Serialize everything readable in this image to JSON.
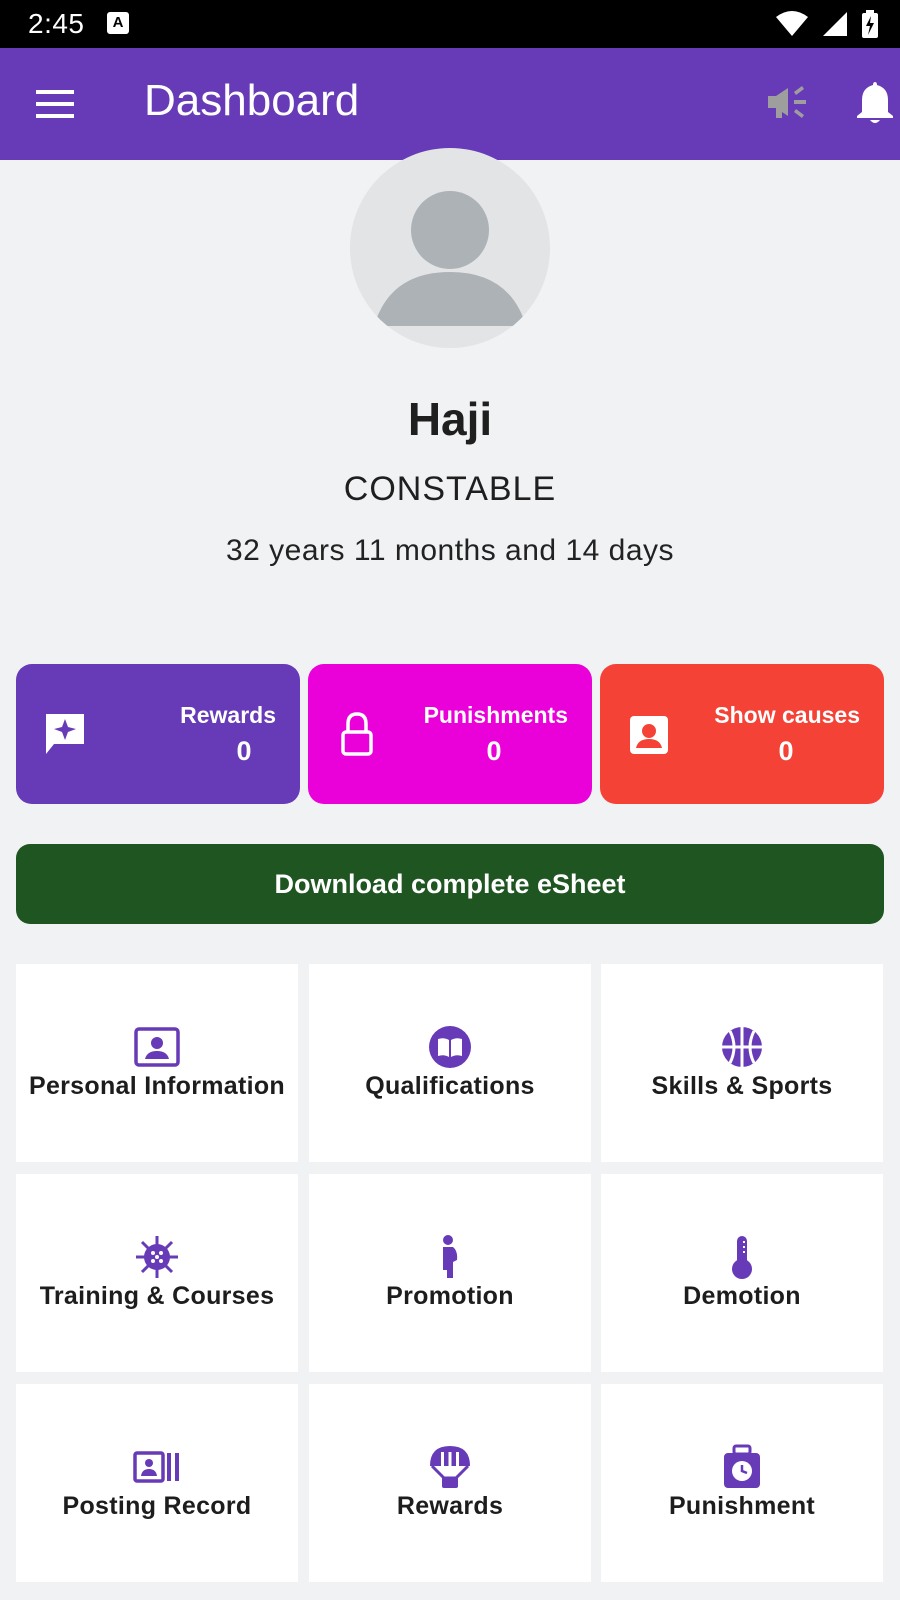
{
  "status_bar": {
    "time": "2:45",
    "notification_icon": "A"
  },
  "app_bar": {
    "title": "Dashboard",
    "icons": [
      "menu-icon",
      "megaphone-icon",
      "bell-icon"
    ]
  },
  "profile": {
    "name": "Haji",
    "rank": "CONSTABLE",
    "service_length": "32 years 11 months and 14 days"
  },
  "stats": [
    {
      "label": "Rewards",
      "value": "0",
      "icon": "reward-star-icon",
      "color": "#673ab7"
    },
    {
      "label": "Punishments",
      "value": "0",
      "icon": "lock-icon",
      "color": "#ea00d9"
    },
    {
      "label": "Show causes",
      "value": "0",
      "icon": "account-box-icon",
      "color": "#f44336"
    }
  ],
  "download_button": {
    "label": "Download complete eSheet",
    "color": "#1e5520"
  },
  "tiles": [
    {
      "label": "Personal Information",
      "icon": "id-card-icon"
    },
    {
      "label": "Qualifications",
      "icon": "book-icon"
    },
    {
      "label": "Skills & Sports",
      "icon": "basketball-icon"
    },
    {
      "label": "Training & Courses",
      "icon": "virus-icon"
    },
    {
      "label": "Promotion",
      "icon": "pregnant-woman-icon"
    },
    {
      "label": "Demotion",
      "icon": "thermometer-icon"
    },
    {
      "label": "Posting Record",
      "icon": "portrait-cards-icon"
    },
    {
      "label": "Rewards",
      "icon": "parachute-icon"
    },
    {
      "label": "Punishment",
      "icon": "timer-bag-icon"
    }
  ],
  "accent_color": "#673ab7"
}
